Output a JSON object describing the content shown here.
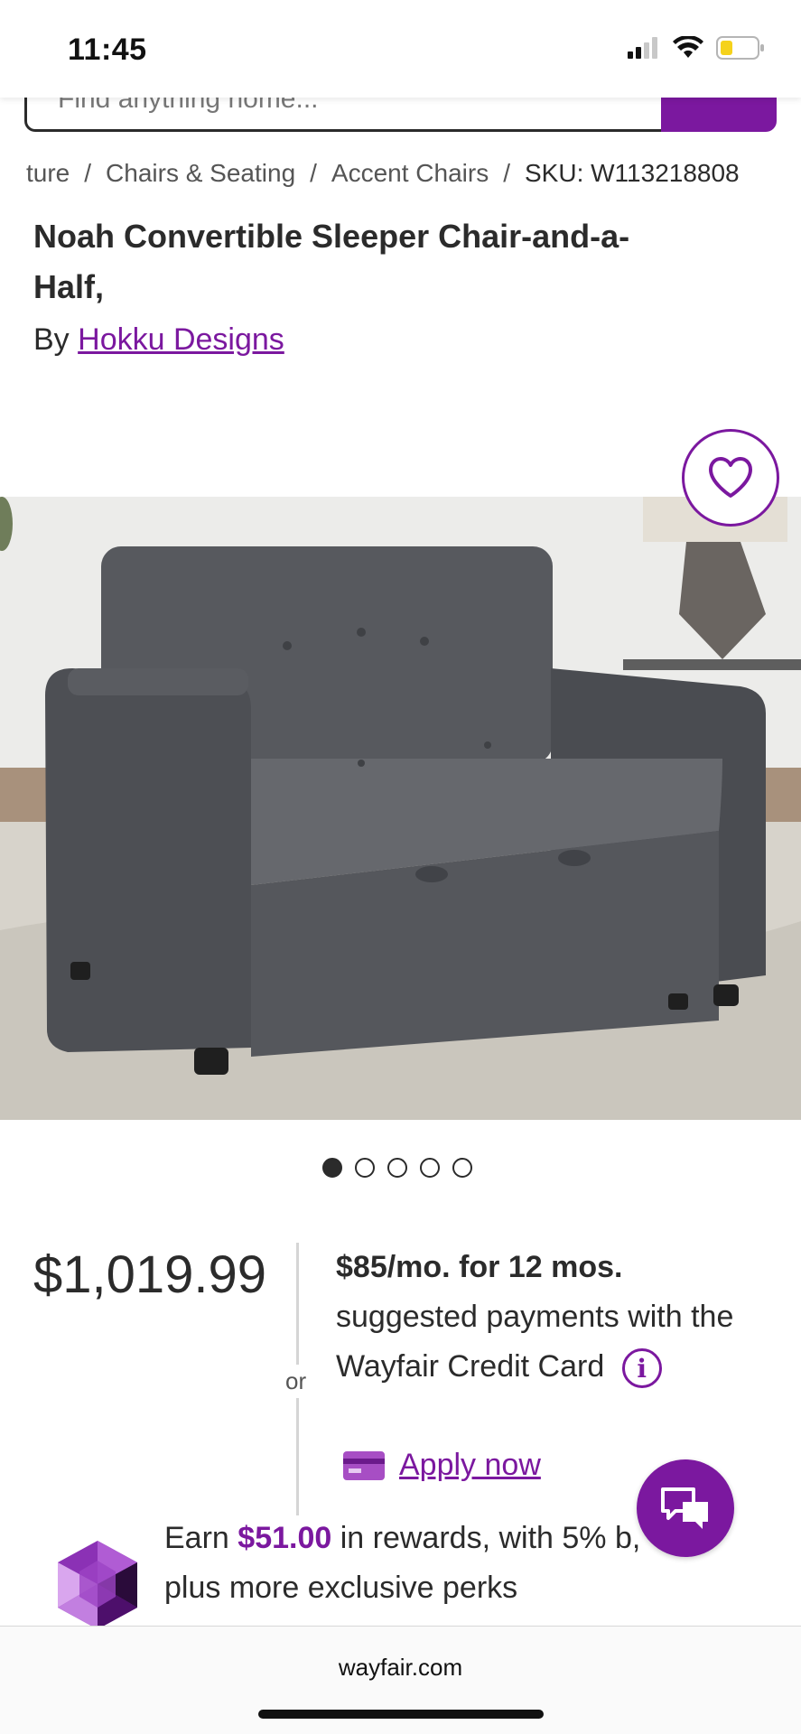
{
  "status_bar": {
    "time": "11:45"
  },
  "search": {
    "placeholder": "Find anything home..."
  },
  "breadcrumb": {
    "items": [
      "ture",
      "Chairs & Seating",
      "Accent Chairs"
    ],
    "separator": "/",
    "sku": "SKU: W113218808"
  },
  "product": {
    "title": "Noah Convertible Sleeper Chair-and-a-Half,",
    "by_label": "By",
    "brand": "Hokku Designs",
    "image_count": 5,
    "active_image": 1
  },
  "price": {
    "amount": "$1,019.99",
    "or_label": "or",
    "financing_bold": "$85/mo. for 12 mos.",
    "financing_text": "suggested payments with the Wayfair Credit Card",
    "info_glyph": "i",
    "apply_label": "Apply now"
  },
  "rewards": {
    "prefix": "Earn",
    "amount": "$51.00",
    "suffix": "in rewards, with 5% b",
    "suffix_end": ",",
    "line2": "plus more exclusive perks"
  },
  "browser": {
    "url": "wayfair.com"
  },
  "colors": {
    "brand": "#7b189f",
    "text": "#2b2b2b"
  },
  "icons": [
    "signal-icon",
    "wifi-icon",
    "battery-icon",
    "search-icon",
    "heart-icon",
    "info-icon",
    "credit-card-icon",
    "chat-icon",
    "rewards-gem-icon"
  ]
}
